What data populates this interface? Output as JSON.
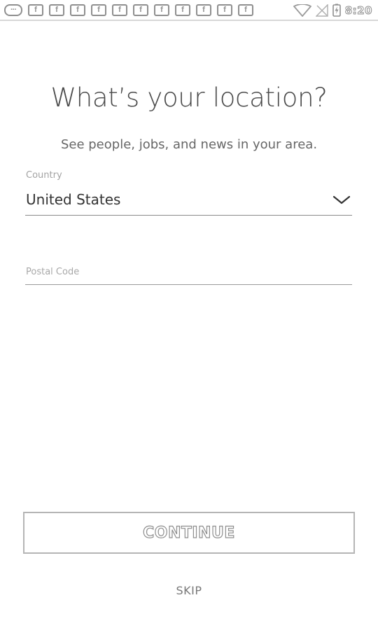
{
  "status_bar": {
    "notification_icons": [
      {
        "icon": "chat-bubble-icon",
        "glyph": "···"
      },
      {
        "icon": "facebook-icon",
        "glyph": "f"
      },
      {
        "icon": "facebook-icon",
        "glyph": "f"
      },
      {
        "icon": "facebook-icon",
        "glyph": "f"
      },
      {
        "icon": "facebook-icon",
        "glyph": "f"
      },
      {
        "icon": "facebook-icon",
        "glyph": "f"
      },
      {
        "icon": "facebook-icon",
        "glyph": "f"
      },
      {
        "icon": "facebook-icon",
        "glyph": "f"
      },
      {
        "icon": "facebook-icon",
        "glyph": "f"
      },
      {
        "icon": "facebook-icon",
        "glyph": "f"
      },
      {
        "icon": "facebook-icon",
        "glyph": "f"
      },
      {
        "icon": "facebook-icon",
        "glyph": "f"
      }
    ],
    "right_icons": [
      "wifi-icon",
      "signal-icon",
      "battery-charging-icon"
    ],
    "time": "8:20"
  },
  "page": {
    "title": "What’s your location?",
    "subtitle": "See people, jobs, and news in your area."
  },
  "form": {
    "country": {
      "label": "Country",
      "value": "United States",
      "icon": "chevron-down-icon"
    },
    "postal_code": {
      "placeholder": "Postal Code",
      "value": ""
    }
  },
  "actions": {
    "continue_label": "CONTINUE",
    "skip_label": "SKIP"
  },
  "colors": {
    "background": "#ffffff",
    "text_primary": "#333333",
    "text_secondary": "#666666",
    "hint": "#a3a3a3",
    "divider": "#8a8a8a",
    "button_border": "#b5b5b5"
  }
}
